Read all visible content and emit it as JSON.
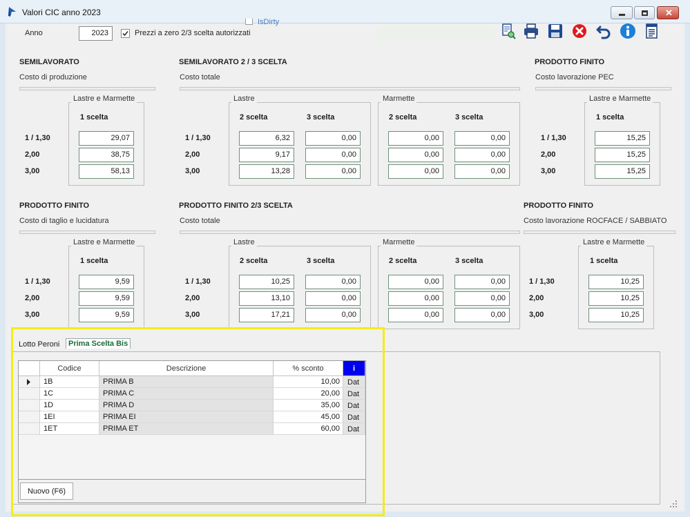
{
  "window": {
    "title": "Valori CIC anno 2023"
  },
  "header": {
    "anno_label": "Anno",
    "anno_value": "2023",
    "checkbox_label": "Prezzi a zero 2/3 scelta autorizzati",
    "checkbox_checked": true,
    "isdirty_label": "IsDirty"
  },
  "toolbar_icons": [
    "preview-icon",
    "print-icon",
    "save-icon",
    "delete-icon",
    "undo-icon",
    "info-icon",
    "document-icon"
  ],
  "labels": {
    "lastre_marmette": "Lastre e Marmette",
    "lastre": "Lastre",
    "marmette": "Marmette",
    "scelta1": "1 scelta",
    "scelta2": "2 scelta",
    "scelta3": "3 scelta",
    "row1": "1 / 1,30",
    "row2": "2,00",
    "row3": "3,00"
  },
  "sections": {
    "s1": {
      "title": "SEMILAVORATO",
      "sub": "Costo di produzione",
      "values": [
        "29,07",
        "38,75",
        "58,13"
      ]
    },
    "s2": {
      "title": "SEMILAVORATO 2 / 3 SCELTA",
      "sub": "Costo totale",
      "lastre2": [
        "6,32",
        "9,17",
        "13,28"
      ],
      "lastre3": [
        "0,00",
        "0,00",
        "0,00"
      ],
      "marm2": [
        "0,00",
        "0,00",
        "0,00"
      ],
      "marm3": [
        "0,00",
        "0,00",
        "0,00"
      ]
    },
    "s3": {
      "title": "PRODOTTO FINITO",
      "sub": "Costo lavorazione PEC",
      "values": [
        "15,25",
        "15,25",
        "15,25"
      ]
    },
    "s4": {
      "title": "PRODOTTO FINITO",
      "sub": "Costo di taglio e lucidatura",
      "values": [
        "9,59",
        "9,59",
        "9,59"
      ]
    },
    "s5": {
      "title": "PRODOTTO FINITO 2/3 SCELTA",
      "sub": "Costo totale",
      "lastre2": [
        "10,25",
        "13,10",
        "17,21"
      ],
      "lastre3": [
        "0,00",
        "0,00",
        "0,00"
      ],
      "marm2": [
        "0,00",
        "0,00",
        "0,00"
      ],
      "marm3": [
        "0,00",
        "0,00",
        "0,00"
      ]
    },
    "s6": {
      "title": "PRODOTTO FINITO",
      "sub": "Costo lavorazione ROCFACE / SABBIATO",
      "values": [
        "10,25",
        "10,25",
        "10,25"
      ]
    }
  },
  "tabs": [
    "Lotto Peroni",
    "Prima Scelta Bis"
  ],
  "active_tab": "Prima Scelta Bis",
  "grid": {
    "columns": [
      "Codice",
      "Descrizione",
      "% sconto",
      "i"
    ],
    "rows": [
      {
        "codice": "1B",
        "descrizione": "PRIMA B",
        "sconto": "10,00",
        "extra": "Dat"
      },
      {
        "codice": "1C",
        "descrizione": "PRIMA C",
        "sconto": "20,00",
        "extra": "Dat"
      },
      {
        "codice": "1D",
        "descrizione": "PRIMA D",
        "sconto": "35,00",
        "extra": "Dat"
      },
      {
        "codice": "1EI",
        "descrizione": "PRIMA EI",
        "sconto": "45,00",
        "extra": "Dat"
      },
      {
        "codice": "1ET",
        "descrizione": "PRIMA ET",
        "sconto": "60,00",
        "extra": "Dat"
      }
    ]
  },
  "buttons": {
    "nuovo": "Nuovo (F6)"
  },
  "colors": {
    "highlight": "#f5ec17",
    "info_header": "#0000ee",
    "field_border": "#6f8f7a"
  }
}
